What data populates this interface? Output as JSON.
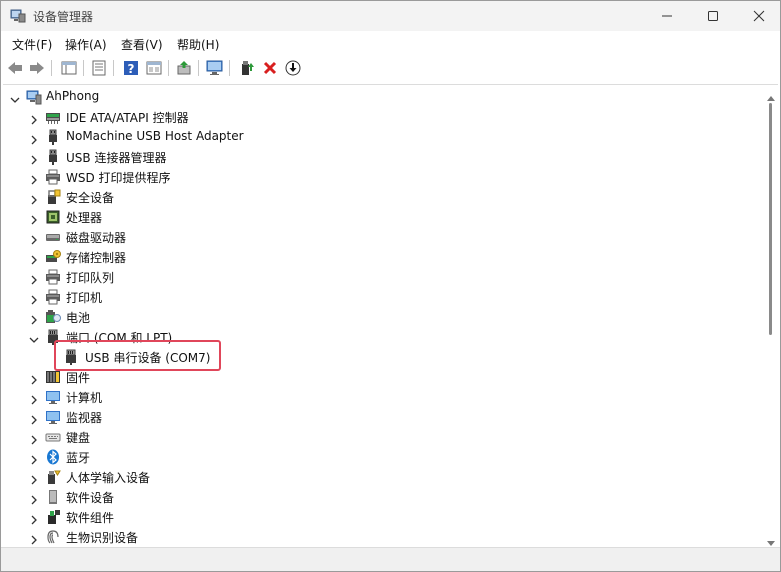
{
  "window": {
    "title": "设备管理器"
  },
  "menu": [
    {
      "label": "文件(F)"
    },
    {
      "label": "操作(A)"
    },
    {
      "label": "查看(V)"
    },
    {
      "label": "帮助(H)"
    }
  ],
  "toolbar": {
    "buttons": [
      "back-icon",
      "forward-icon",
      "show-hide-tree-icon",
      "properties-icon",
      "help-icon",
      "view-icon",
      "update-driver-icon",
      "scan-hardware-icon",
      "enable-device-icon",
      "uninstall-icon",
      "download-icon"
    ]
  },
  "tree": {
    "root": "AhPhong",
    "categories": [
      {
        "label": "IDE ATA/ATAPI 控制器",
        "icon": "ide-controller-icon",
        "expanded": false
      },
      {
        "label": "NoMachine USB Host Adapter",
        "icon": "usb-plug-icon",
        "expanded": false
      },
      {
        "label": "USB 连接器管理器",
        "icon": "usb-plug-icon",
        "expanded": false
      },
      {
        "label": "WSD 打印提供程序",
        "icon": "printer-icon",
        "expanded": false
      },
      {
        "label": "安全设备",
        "icon": "security-device-icon",
        "expanded": false
      },
      {
        "label": "处理器",
        "icon": "processor-icon",
        "expanded": false
      },
      {
        "label": "磁盘驱动器",
        "icon": "disk-drive-icon",
        "expanded": false
      },
      {
        "label": "存储控制器",
        "icon": "storage-controller-icon",
        "expanded": false
      },
      {
        "label": "打印队列",
        "icon": "printer-icon",
        "expanded": false
      },
      {
        "label": "打印机",
        "icon": "printer-icon",
        "expanded": false
      },
      {
        "label": "电池",
        "icon": "battery-icon",
        "expanded": false
      },
      {
        "label": "端口 (COM 和 LPT)",
        "icon": "port-icon",
        "expanded": true
      },
      {
        "label": "USB 串行设备 (COM7)",
        "icon": "port-icon",
        "child": true
      },
      {
        "label": "固件",
        "icon": "firmware-icon",
        "expanded": false
      },
      {
        "label": "计算机",
        "icon": "computer-icon",
        "expanded": false
      },
      {
        "label": "监视器",
        "icon": "monitor-icon",
        "expanded": false
      },
      {
        "label": "键盘",
        "icon": "keyboard-icon",
        "expanded": false
      },
      {
        "label": "蓝牙",
        "icon": "bluetooth-icon",
        "expanded": false
      },
      {
        "label": "人体学输入设备",
        "icon": "hid-icon",
        "expanded": false
      },
      {
        "label": "软件设备",
        "icon": "software-device-icon",
        "expanded": false
      },
      {
        "label": "软件组件",
        "icon": "software-component-icon",
        "expanded": false
      },
      {
        "label": "生物识别设备",
        "icon": "biometric-icon",
        "expanded": false
      }
    ]
  },
  "colors": {
    "highlight": "#e0465a",
    "accent": "#0a64d8"
  }
}
